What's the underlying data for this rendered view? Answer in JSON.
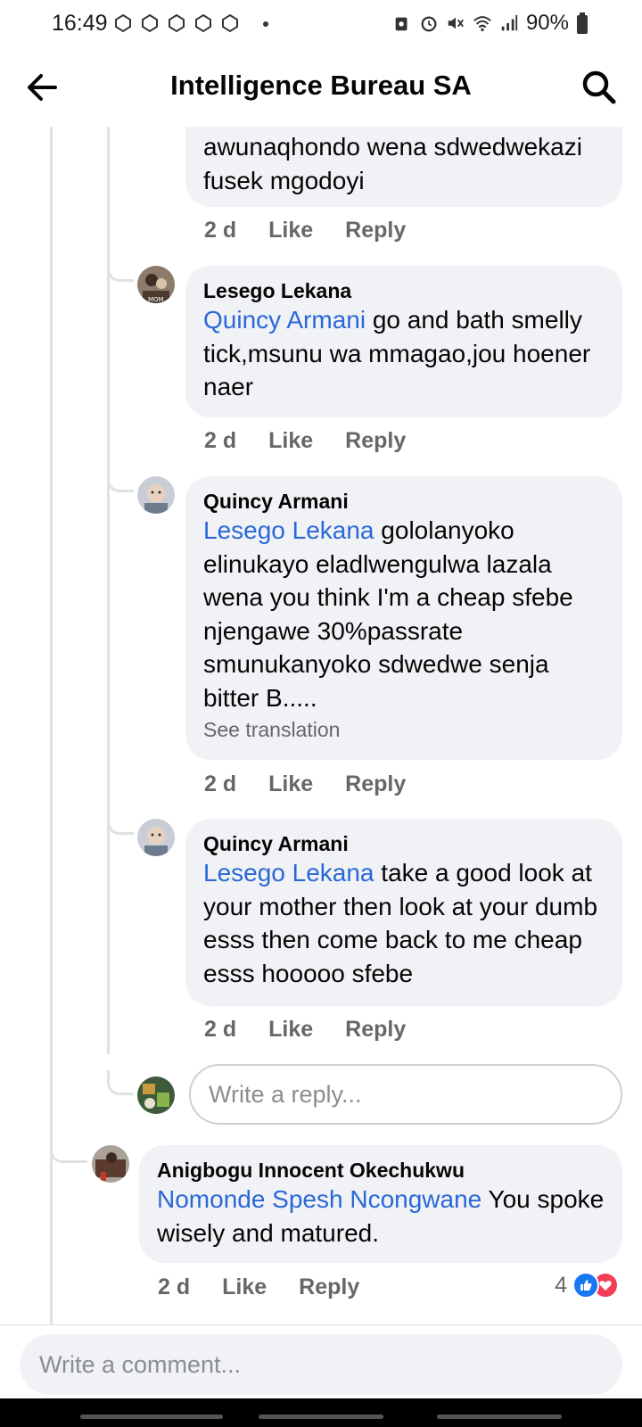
{
  "status_bar": {
    "time": "16:49",
    "battery": "90%",
    "icons": [
      "notification-icon",
      "notification-icon",
      "notification-icon",
      "notification-icon",
      "notification-icon",
      "alarm-icon",
      "mute-icon",
      "wifi-icon",
      "signal-icon",
      "battery-icon"
    ]
  },
  "header": {
    "title": "Intelligence Bureau SA",
    "back_icon": "arrow-left-icon",
    "search_icon": "search-icon"
  },
  "colors": {
    "mention": "#2a68d8",
    "bubble": "#f0f2f5",
    "secondary_text": "#65676b",
    "like_blue": "#1877f2",
    "love_red": "#f33e58"
  },
  "comments": [
    {
      "text": "awunaqhondo wena sdwedwekazi fusek mgodoyi",
      "time": "2 d",
      "like": "Like",
      "reply": "Reply"
    },
    {
      "author": "Lesego Lekana",
      "mention": "Quincy Armani",
      "text": " go and bath smelly tick,msunu wa mmagao,jou hoener naer",
      "time": "2 d",
      "like": "Like",
      "reply": "Reply"
    },
    {
      "author": "Quincy Armani",
      "mention": "Lesego Lekana",
      "text": " gololanyoko elinukayo eladlwengulwa lazala wena you think I'm a cheap sfebe njengawe 30%passrate smunukanyoko sdwedwe senja bitter B.....",
      "see_translation": "See translation",
      "time": "2 d",
      "like": "Like",
      "reply": "Reply"
    },
    {
      "author": "Quincy Armani",
      "mention": "Lesego Lekana",
      "text": " take a good look at your mother then look at your dumb esss then come back to me cheap esss hooooo sfebe",
      "time": "2 d",
      "like": "Like",
      "reply": "Reply"
    },
    {
      "author": "Anigbogu Innocent Okechukwu",
      "mention": "Nomonde Spesh Ncongwane",
      "text": " You spoke wisely and matured.",
      "time": "2 d",
      "like": "Like",
      "reply": "Reply",
      "reaction_count": "4"
    }
  ],
  "reply_placeholder": "Write a reply...",
  "comment_placeholder": "Write a comment..."
}
